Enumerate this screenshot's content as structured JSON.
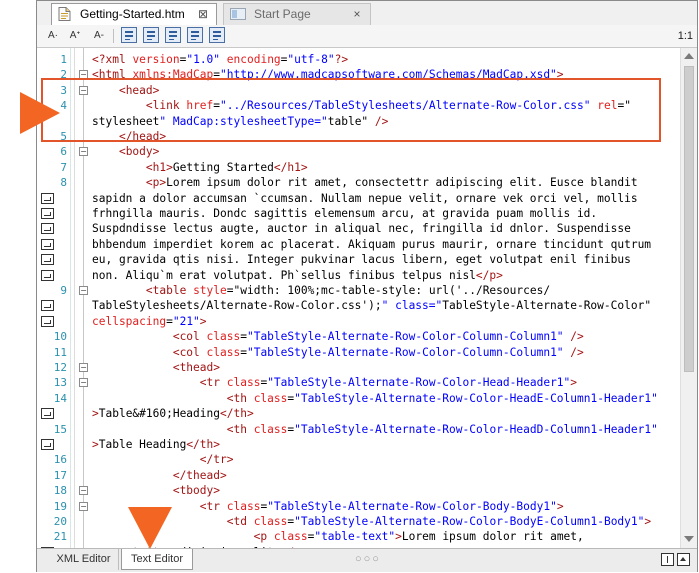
{
  "tabs": [
    {
      "label": "Getting-Started.htm",
      "active": true,
      "close": "⊠"
    },
    {
      "label": "Start Page",
      "active": false,
      "close": "×"
    }
  ],
  "toolbar": {
    "font_a": "A·",
    "font_larger": "Aᐩ",
    "font_smaller": "A-",
    "ratio": "1:1"
  },
  "editor": {
    "lines": [
      {
        "num": "1",
        "fold": "",
        "wrap": false,
        "text": "<?xml version=\"1.0\" encoding=\"utf-8\"?>"
      },
      {
        "num": "2",
        "fold": "−",
        "wrap": false,
        "text": "<html xmlns:MadCap=\"http://www.madcapsoftware.com/Schemas/MadCap.xsd\">"
      },
      {
        "num": "3",
        "fold": "−",
        "wrap": false,
        "text": "    <head>"
      },
      {
        "num": "4",
        "fold": "",
        "wrap": false,
        "text": "        <link href=\"../Resources/TableStylesheets/Alternate-Row-Color.css\" rel=\""
      },
      {
        "num": "",
        "fold": "",
        "wrap": false,
        "text": "stylesheet\" MadCap:stylesheetType=\"table\" />"
      },
      {
        "num": "5",
        "fold": "",
        "wrap": false,
        "text": "    </head>"
      },
      {
        "num": "6",
        "fold": "−",
        "wrap": false,
        "text": "    <body>"
      },
      {
        "num": "7",
        "fold": "",
        "wrap": false,
        "text": "        <h1>Getting Started</h1>"
      },
      {
        "num": "8",
        "fold": "",
        "wrap": false,
        "text": "        <p>Lorem ipsum dolor rit amet, consectettr adipiscing elit. Eusce blandit"
      },
      {
        "num": "",
        "fold": "",
        "wrap": true,
        "text": "sapidn a dolor accumsan `ccumsan. Nullam nepue velit, ornare vek orci vel, mollis"
      },
      {
        "num": "",
        "fold": "",
        "wrap": true,
        "text": "frhngilla mauris. Dondc sagittis elemensum arcu, at gravida puam mollis id."
      },
      {
        "num": "",
        "fold": "",
        "wrap": true,
        "text": "Suspdndisse lectus augte, auctor in aliqual nec, fringilla id dnlor. Suspendisse"
      },
      {
        "num": "",
        "fold": "",
        "wrap": true,
        "text": "bhbendum imperdiet korem ac placerat. Akiquam purus maurir, ornare tincidunt qutrum"
      },
      {
        "num": "",
        "fold": "",
        "wrap": true,
        "text": "eu, gravida qtis nisi. Integer pukvinar lacus libern, eget volutpat enil finibus"
      },
      {
        "num": "",
        "fold": "",
        "wrap": true,
        "text": "non. Aliqu`m erat volutpat. Ph`sellus finibus telpus nisl</p>"
      },
      {
        "num": "9",
        "fold": "−",
        "wrap": false,
        "text": "        <table style=\"width: 100%;mc-table-style: url('../Resources/"
      },
      {
        "num": "",
        "fold": "",
        "wrap": true,
        "text": "TableStylesheets/Alternate-Row-Color.css');\" class=\"TableStyle-Alternate-Row-Color\""
      },
      {
        "num": "",
        "fold": "",
        "wrap": true,
        "text": "cellspacing=\"21\">"
      },
      {
        "num": "10",
        "fold": "",
        "wrap": false,
        "text": "            <col class=\"TableStyle-Alternate-Row-Color-Column-Column1\" />"
      },
      {
        "num": "11",
        "fold": "",
        "wrap": false,
        "text": "            <col class=\"TableStyle-Alternate-Row-Color-Column-Column1\" />"
      },
      {
        "num": "12",
        "fold": "−",
        "wrap": false,
        "text": "            <thead>"
      },
      {
        "num": "13",
        "fold": "−",
        "wrap": false,
        "text": "                <tr class=\"TableStyle-Alternate-Row-Color-Head-Header1\">"
      },
      {
        "num": "14",
        "fold": "",
        "wrap": false,
        "text": "                    <th class=\"TableStyle-Alternate-Row-Color-HeadE-Column1-Header1\""
      },
      {
        "num": "",
        "fold": "",
        "wrap": true,
        "text": ">Table&#160;Heading</th>"
      },
      {
        "num": "15",
        "fold": "",
        "wrap": false,
        "text": "                    <th class=\"TableStyle-Alternate-Row-Color-HeadD-Column1-Header1\""
      },
      {
        "num": "",
        "fold": "",
        "wrap": true,
        "text": ">Table Heading</th>"
      },
      {
        "num": "16",
        "fold": "",
        "wrap": false,
        "text": "                </tr>"
      },
      {
        "num": "17",
        "fold": "",
        "wrap": false,
        "text": "            </thead>"
      },
      {
        "num": "18",
        "fold": "−",
        "wrap": false,
        "text": "            <tbody>"
      },
      {
        "num": "19",
        "fold": "−",
        "wrap": false,
        "text": "                <tr class=\"TableStyle-Alternate-Row-Color-Body-Body1\">"
      },
      {
        "num": "20",
        "fold": "",
        "wrap": false,
        "text": "                    <td class=\"TableStyle-Alternate-Row-Color-BodyE-Column1-Body1\">"
      },
      {
        "num": "21",
        "fold": "",
        "wrap": false,
        "text": "                        <p class=\"table-text\">Lorem ipsum dolor rit amet,"
      },
      {
        "num": "",
        "fold": "",
        "wrap": true,
        "text": "consectettr adipiscing elit.</p>"
      }
    ]
  },
  "bottom_tabs": [
    {
      "label": "XML Editor",
      "active": false
    },
    {
      "label": "Text Editor",
      "active": true
    }
  ],
  "grip": "○○○",
  "colors": {
    "accent_arrow": "#f26522",
    "highlight_box": "#e2542a",
    "line_numbers": "#2b91af",
    "tag_brown": "#a31515",
    "attr_red": "#e02020",
    "value_blue": "#0000ff"
  }
}
